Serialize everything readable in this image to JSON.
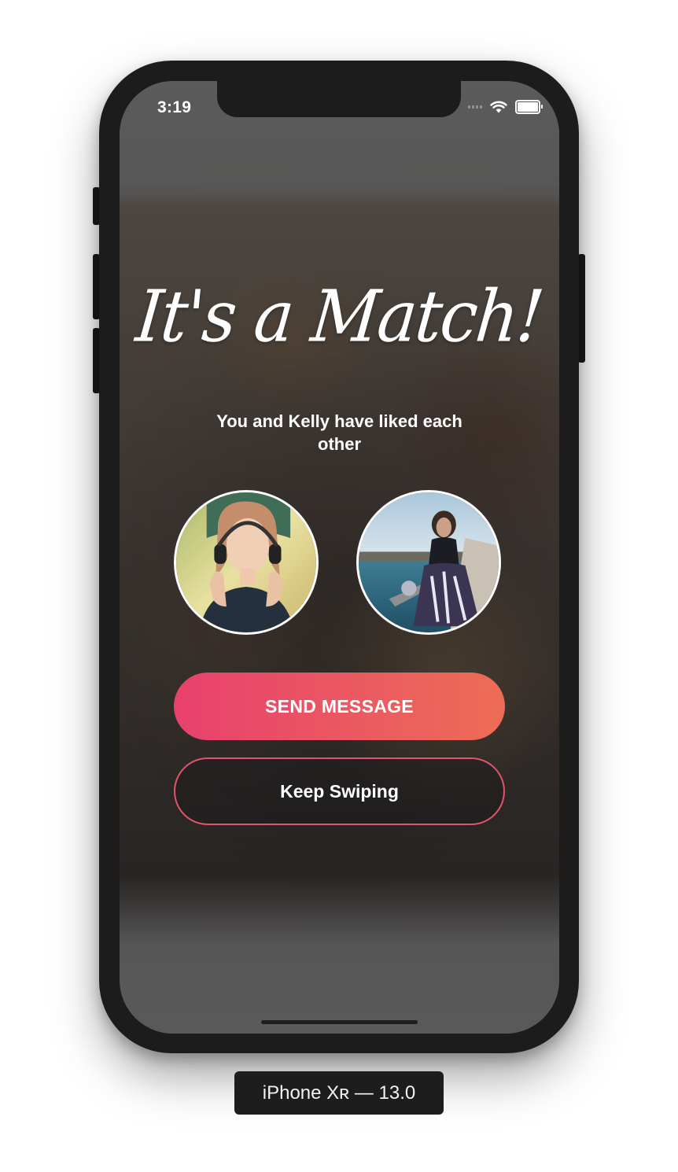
{
  "status_bar": {
    "time": "3:19",
    "icons": [
      "signal-icon",
      "wifi-icon",
      "battery-icon"
    ]
  },
  "match": {
    "title": "It's a Match!",
    "subtitle": "You and Kelly have liked each other",
    "avatars": [
      {
        "description_icon": "user-avatar-photo"
      },
      {
        "description_icon": "match-avatar-photo"
      }
    ],
    "send_button_label": "SEND MESSAGE",
    "keep_button_label": "Keep Swiping"
  },
  "device": {
    "label": "iPhone Xʀ — 13.0"
  },
  "colors": {
    "send_gradient_start": "#e8416d",
    "send_gradient_end": "#ed6d56",
    "keep_border": "#e2546b",
    "phone_frame": "#1c1c1c"
  }
}
